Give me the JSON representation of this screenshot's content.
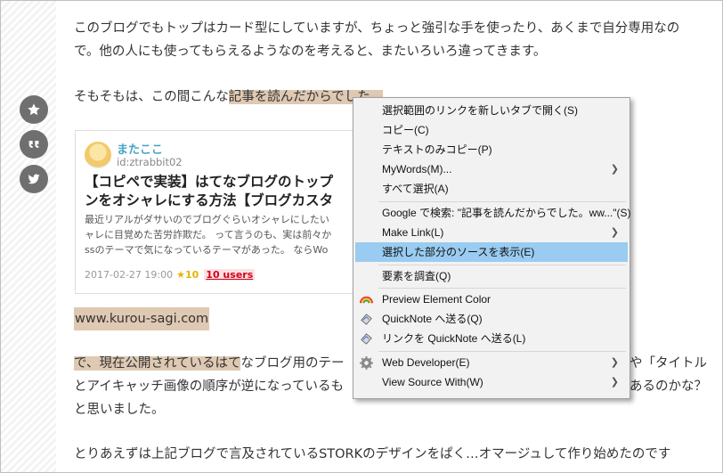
{
  "article": {
    "p1_line1": "このブログでもトップはカード型にしていますが、ちょっと強引な手を使ったり、あくまで自分専用なの",
    "p1_line2": "で。他の人にも使ってもらえるようなのを考えると、またいろいろ違ってきます。",
    "p2_before": "そもそもは、この間こんな",
    "p2_highlight": "記事を読んだからでした。",
    "url": "www.kurou-sagi.com",
    "p3_highlight": "で、現在公開されているはて",
    "p3_rest": "なブログ用のテー",
    "p3_right": "や「タイトル",
    "p3_line2_left": "とアイキャッチ画像の順序が逆になっているも",
    "p3_line2_right": "あるのかな？",
    "p3_line3": "と思いました。",
    "p4": "とりあえずは上記ブログで言及されているSTORKのデザインをぱく…オマージュして作り始めたのです"
  },
  "share": {
    "star_icon": "star-icon",
    "quote_icon": "quote-icon",
    "twitter_icon": "twitter-icon"
  },
  "card": {
    "author_name": "またここ",
    "author_id": "id:ztrabbit02",
    "title_line1": "【コピペで実装】はてなブログのトップ",
    "title_line2": "ンをオシャレにする方法【ブログカスタ",
    "excerpt_line1": "最近リアルがダサいのでブログぐらいオシャレにしたい",
    "excerpt_line2": "ャレに目覚めた苦労詐欺だ。 って言うのも、実は前々か",
    "excerpt_line3": "ssのテーマで気になっているテーマがあった。 ならWo",
    "date": "2017-02-27 19:00",
    "stars": "★10",
    "users": "10 users"
  },
  "context_menu": {
    "items": [
      {
        "label": "選択範囲のリンクを新しいタブで開く(S)"
      },
      {
        "label": "コピー(C)"
      },
      {
        "label": "テキストのみコピー(P)"
      },
      {
        "label": "MyWords(M)..."
      },
      {
        "label": "すべて選択(A)"
      },
      {
        "label": "Google で検索: \"記事を読んだからでした。ww...\"(S)"
      },
      {
        "label": "Make Link(L)"
      },
      {
        "label": "選択した部分のソースを表示(E)"
      },
      {
        "label": "要素を調査(Q)"
      },
      {
        "label": "Preview Element Color"
      },
      {
        "label": "QuickNote へ送る(Q)"
      },
      {
        "label": "リンクを QuickNote へ送る(L)"
      },
      {
        "label": "Web Developer(E)"
      },
      {
        "label": "View Source With(W)"
      }
    ],
    "selected_item": "選択した部分のソースを表示(E)",
    "colors": {
      "selected_bg": "#99ccf0",
      "menu_bg": "#f2f2f2"
    }
  },
  "colors": {
    "highlight": "#dfc9b3",
    "author_link": "#4aa3c8",
    "star": "#e8b400",
    "users": "#d0021b"
  }
}
